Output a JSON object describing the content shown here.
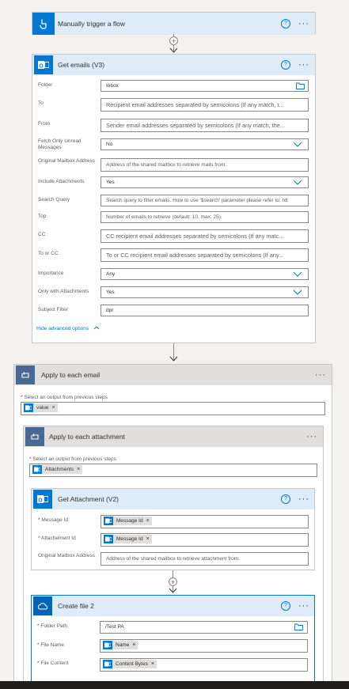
{
  "trigger": {
    "title": "Manually trigger a flow"
  },
  "get_emails": {
    "title": "Get emails (V3)",
    "fields": [
      {
        "label": "Folder",
        "value": "Inbox"
      },
      {
        "label": "To",
        "placeholder": "Recipient email addresses separated by semicolons (If any match, t..."
      },
      {
        "label": "From",
        "placeholder": "Sender email addresses separated by semicolons (If any match, the..."
      },
      {
        "label": "Fetch Only Unread Messages",
        "value": "No"
      },
      {
        "label": "Original Mailbox Address",
        "placeholder": "Address of the shared mailbox to retrieve mails from."
      },
      {
        "label": "Include Attachments",
        "value": "Yes"
      },
      {
        "label": "Search Query",
        "placeholder": "Search query to filter emails. How to use '$search' parameter please refer to: htt"
      },
      {
        "label": "Top",
        "placeholder": "Number of emails to retrieve (default: 10, max: 25)."
      },
      {
        "label": "CC",
        "placeholder": "CC recipient email addresses separated by semicolons (If any matc..."
      },
      {
        "label": "To or CC",
        "placeholder": "To or CC recipient email addresses separated by semicolons (If any..."
      },
      {
        "label": "Importance",
        "value": "Any"
      },
      {
        "label": "Only with Attachments",
        "value": "Yes"
      },
      {
        "label": "Subject Filter",
        "value": "dpr"
      }
    ],
    "advanced_link": "Hide advanced options"
  },
  "apply_each_email": {
    "title": "Apply to each email",
    "select_label": "Select an output from previous steps",
    "token": "value"
  },
  "apply_each_attachment": {
    "title": "Apply to each attachment",
    "select_label": "Select an output from previous steps",
    "token": "Attachments"
  },
  "get_attachment": {
    "title": "Get Attachment (V2)",
    "message_id_label": "Message Id",
    "message_id_token": "Message Id",
    "attachment_id_label": "Attachement Id",
    "attachment_id_token": "Message Id",
    "mailbox_label": "Original Mailbox Address",
    "mailbox_placeholder": "Address of the shared mailbox to retrieve attachment from."
  },
  "create_file": {
    "title": "Create file 2",
    "folder_label": "Folder Path",
    "folder_value": "/Test PA",
    "name_label": "File Name",
    "name_token": "Name",
    "content_label": "File Content",
    "content_token": "Content Bytes"
  },
  "icons": {
    "help": "?",
    "more": "···",
    "remove": "×",
    "add": "+",
    "required": "*",
    "expand": "^"
  },
  "colors": {
    "accent": "#0078d4",
    "header_bg": "#deecf9",
    "canvas": "#f3f2f1",
    "onedrive_selected_border": "#0078d4"
  }
}
